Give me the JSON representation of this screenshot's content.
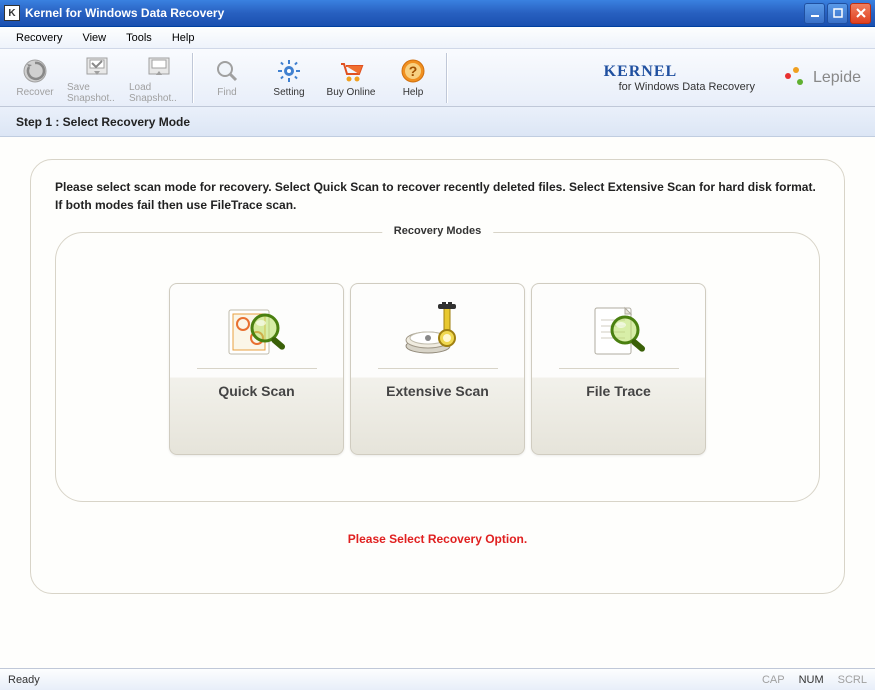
{
  "window": {
    "title": "Kernel for Windows Data Recovery"
  },
  "menu": {
    "recovery": "Recovery",
    "view": "View",
    "tools": "Tools",
    "help": "Help"
  },
  "toolbar": {
    "recover": "Recover",
    "save_snapshot": "Save Snapshot..",
    "load_snapshot": "Load Snapshot..",
    "find": "Find",
    "setting": "Setting",
    "buy_online": "Buy Online",
    "help": "Help"
  },
  "brand": {
    "kernel": "KERNEL",
    "subtitle": "for Windows Data Recovery",
    "lepide": "Lepide"
  },
  "step": {
    "title": "Step 1 : Select Recovery Mode"
  },
  "instructions": "Please select scan mode for recovery. Select Quick Scan to recover recently deleted files. Select Extensive Scan for hard disk format. If both modes fail then use FileTrace scan.",
  "fieldset": {
    "legend": "Recovery Modes"
  },
  "modes": {
    "quick": "Quick Scan",
    "extensive": "Extensive Scan",
    "filetrace": "File Trace"
  },
  "option_msg": "Please Select Recovery Option.",
  "status": {
    "ready": "Ready",
    "cap": "CAP",
    "num": "NUM",
    "scrl": "SCRL"
  }
}
